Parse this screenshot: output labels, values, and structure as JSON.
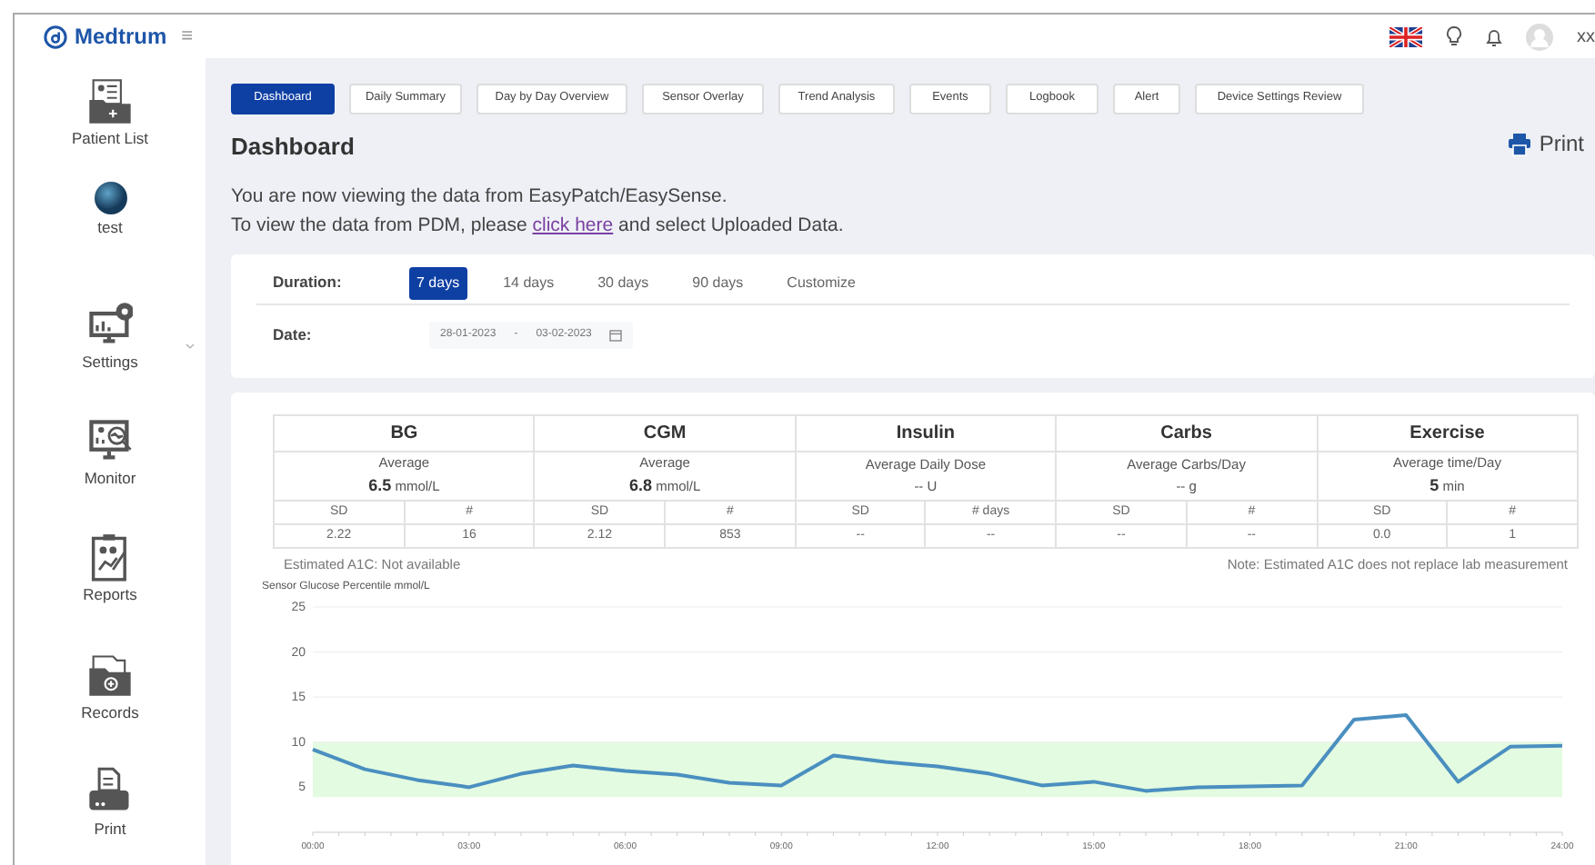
{
  "brand": {
    "name": "Medtrum",
    "menu_glyph": "≡"
  },
  "header": {
    "user": "xx"
  },
  "sidebar": {
    "items": [
      {
        "kind": "patients",
        "label": "Patient List",
        "expandable": false
      },
      {
        "kind": "avatar",
        "label": "test",
        "expandable": false
      },
      {
        "kind": "settings",
        "label": "Settings",
        "expandable": true
      },
      {
        "kind": "monitor",
        "label": "Monitor",
        "expandable": false
      },
      {
        "kind": "reports",
        "label": "Reports",
        "expandable": false
      },
      {
        "kind": "records",
        "label": "Records",
        "expandable": false
      },
      {
        "kind": "print",
        "label": "Print",
        "expandable": false
      }
    ]
  },
  "tabs": [
    {
      "label": "Dashboard",
      "selected": true
    },
    {
      "label": "Daily Summary",
      "selected": false
    },
    {
      "label": "Day by Day Overview",
      "selected": false
    },
    {
      "label": "Sensor Overlay",
      "selected": false
    },
    {
      "label": "Trend Analysis",
      "selected": false
    },
    {
      "label": "Events",
      "selected": false
    },
    {
      "label": "Logbook",
      "selected": false
    },
    {
      "label": "Alert",
      "selected": false
    },
    {
      "label": "Device Settings Review",
      "selected": false
    }
  ],
  "page_title": "Dashboard",
  "print_label": "Print",
  "info": {
    "line1": "You are now viewing the data from EasyPatch/EasySense.",
    "line2_before": "To view the data from PDM, please",
    "link": "click here",
    "line2_after": "and select Uploaded Data."
  },
  "duration": {
    "label": "Duration:",
    "options": [
      {
        "label": "7 days",
        "selected": true
      },
      {
        "label": "14 days",
        "selected": false
      },
      {
        "label": "30 days",
        "selected": false
      },
      {
        "label": "90 days",
        "selected": false
      },
      {
        "label": "Customize",
        "selected": false
      }
    ]
  },
  "date": {
    "label": "Date:",
    "from": "28-01-2023",
    "separator": "-",
    "to": "03-02-2023"
  },
  "summary": [
    {
      "title": "BG",
      "metric": "Average",
      "value": "**6.5** mmol/L",
      "columns": [
        "SD",
        "#"
      ],
      "values": [
        "2.22",
        "16"
      ]
    },
    {
      "title": "CGM",
      "metric": "Average",
      "value": "**6.8** mmol/L",
      "columns": [
        "SD",
        "#"
      ],
      "values": [
        "2.12",
        "853"
      ]
    },
    {
      "title": "Insulin",
      "metric": "Average Daily Dose",
      "value": "-- U",
      "columns": [
        "SD",
        "# days"
      ],
      "values": [
        "--",
        "--"
      ]
    },
    {
      "title": "Carbs",
      "metric": "Average Carbs/Day",
      "value": "-- g",
      "columns": [
        "SD",
        "#"
      ],
      "values": [
        "--",
        "--"
      ]
    },
    {
      "title": "Exercise",
      "metric": "Average time/Day",
      "value": "**5** min",
      "columns": [
        "SD",
        "#"
      ],
      "values": [
        "0.0",
        "1"
      ]
    }
  ],
  "a1c": "Estimated A1C: Not available",
  "a1c_note": "Note: Estimated A1C does not replace lab measurement",
  "chart": {
    "chart_data": {
      "type": "line",
      "title": "Sensor Glucose Percentile mmol/L",
      "x": [
        0,
        1,
        2,
        3,
        4,
        5,
        6,
        7,
        8,
        9,
        10,
        11,
        12,
        13,
        14,
        15,
        16,
        17,
        18,
        19,
        20,
        21,
        22,
        23,
        24
      ],
      "series": [
        {
          "color": "#4a8fc0",
          "values": [
            9.2,
            7,
            5.8,
            5,
            6.5,
            7.4,
            6.8,
            6.4,
            5.5,
            5.2,
            8.5,
            7.8,
            7.3,
            6.5,
            5.2,
            5.6,
            4.6,
            5,
            5.1,
            5.2,
            12.5,
            13,
            5.6,
            9.5,
            9.6
          ]
        }
      ],
      "xlim": [
        0,
        24
      ],
      "ylim": [
        0,
        25
      ],
      "yticks": [
        5,
        10,
        15,
        20,
        25
      ],
      "grid": true,
      "xticks": [
        {
          "value": 0,
          "label": "00:00"
        },
        {
          "value": 3,
          "label": "03:00"
        },
        {
          "value": 6,
          "label": "06:00"
        },
        {
          "value": 9,
          "label": "09:00"
        },
        {
          "value": 12,
          "label": "12:00"
        },
        {
          "value": 15,
          "label": "15:00"
        },
        {
          "value": 18,
          "label": "18:00"
        },
        {
          "value": 21,
          "label": "21:00"
        },
        {
          "value": 24,
          "label": "24:00"
        }
      ],
      "bands": [
        {
          "axis": "y",
          "from": 3.9,
          "to": 10,
          "color": "#e3fbe0"
        }
      ]
    }
  }
}
